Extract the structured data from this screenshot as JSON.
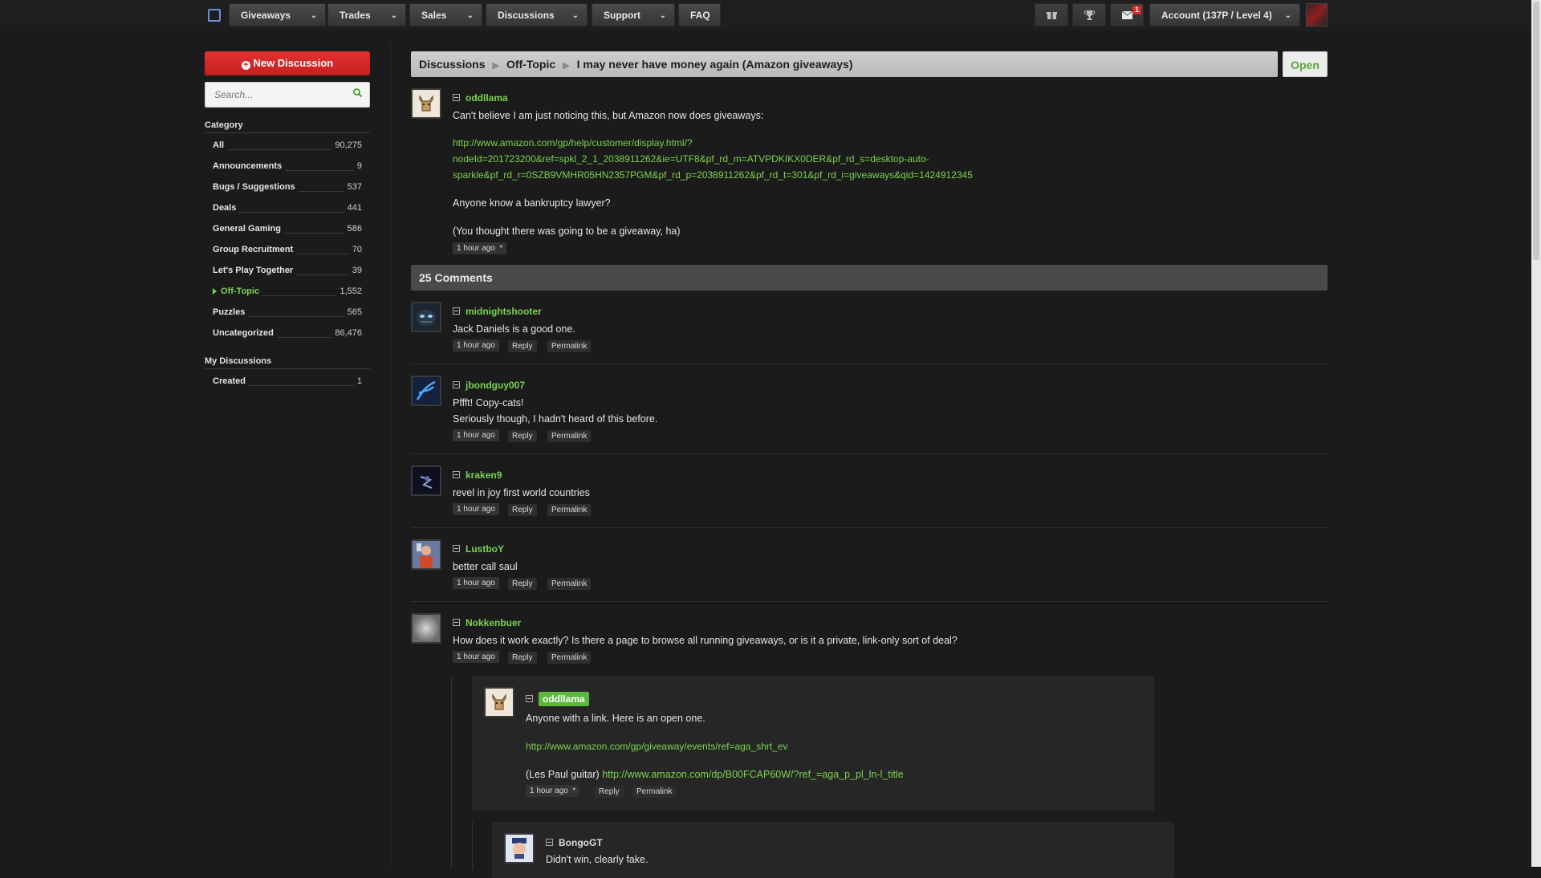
{
  "nav": {
    "items": [
      {
        "label": "Giveaways"
      },
      {
        "label": "Trades"
      },
      {
        "label": "Sales"
      },
      {
        "label": "Discussions"
      },
      {
        "label": "Support"
      }
    ],
    "faq": "FAQ",
    "mail_count": "1",
    "account": "Account (137P / Level 4)"
  },
  "sidebar": {
    "new_discussion": "New Discussion",
    "search_placeholder": "Search...",
    "category_heading": "Category",
    "categories": [
      {
        "name": "All",
        "count": "90,275"
      },
      {
        "name": "Announcements",
        "count": "9"
      },
      {
        "name": "Bugs / Suggestions",
        "count": "537"
      },
      {
        "name": "Deals",
        "count": "441"
      },
      {
        "name": "General Gaming",
        "count": "586"
      },
      {
        "name": "Group Recruitment",
        "count": "70"
      },
      {
        "name": "Let's Play Together",
        "count": "39"
      },
      {
        "name": "Off-Topic",
        "count": "1,552"
      },
      {
        "name": "Puzzles",
        "count": "565"
      },
      {
        "name": "Uncategorized",
        "count": "86,476"
      }
    ],
    "my_heading": "My Discussions",
    "my_items": [
      {
        "name": "Created",
        "count": "1"
      }
    ]
  },
  "breadcrumb": {
    "items": [
      "Discussions",
      "Off-Topic",
      "I may never have money again (Amazon giveaways)"
    ],
    "status": "Open"
  },
  "op": {
    "user": "oddllama",
    "line1": "Can't believe I am just noticing this, but Amazon now does giveaways:",
    "link_lines": [
      "http://www.amazon.com/gp/help/customer/display.html/?",
      "nodeId=201723200&ref=spkl_2_1_2038911262&ie=UTF8&pf_rd_m=ATVPDKIKX0DER&pf_rd_s=desktop-auto-",
      "sparkle&pf_rd_r=0SZB9VMHR05HN2357PGM&pf_rd_p=2038911262&pf_rd_t=301&pf_rd_i=giveaways&qid=1424912345"
    ],
    "line2": "Anyone know a bankruptcy lawyer?",
    "line3": "(You thought there was going to be a giveaway, ha)",
    "time": "1 hour ago",
    "edited": "*"
  },
  "comments_heading": "25 Comments",
  "actions": {
    "reply": "Reply",
    "permalink": "Permalink"
  },
  "comments": [
    {
      "user": "midnightshooter",
      "lines": [
        "Jack Daniels is a good one."
      ],
      "time": "1 hour ago"
    },
    {
      "user": "jbondguy007",
      "lines": [
        "Pffft! Copy-cats!",
        "Seriously though, I hadn't heard of this before."
      ],
      "time": "1 hour ago"
    },
    {
      "user": "kraken9",
      "lines": [
        "revel in joy first world countries"
      ],
      "time": "1 hour ago"
    },
    {
      "user": "LustboY",
      "lines": [
        "better call saul"
      ],
      "time": "1 hour ago"
    },
    {
      "user": "Nokkenbuer",
      "lines": [
        "How does it work exactly? Is there a page to browse all running giveaways, or is it a private, link-only sort of deal?"
      ],
      "time": "1 hour ago"
    }
  ],
  "reply1": {
    "user": "oddllama",
    "line1": "Anyone with a link. Here is an open one.",
    "link1": "http://www.amazon.com/gp/giveaway/events/ref=aga_shrt_ev",
    "line2_prefix": "(Les Paul guitar)",
    "link2": "http://www.amazon.com/dp/B00FCAP60W/?ref_=aga_p_pl_ln-l_title",
    "time": "1 hour ago",
    "edited": "*"
  },
  "reply2": {
    "user": "BongoGT",
    "line1": "Didn't win, clearly fake."
  }
}
